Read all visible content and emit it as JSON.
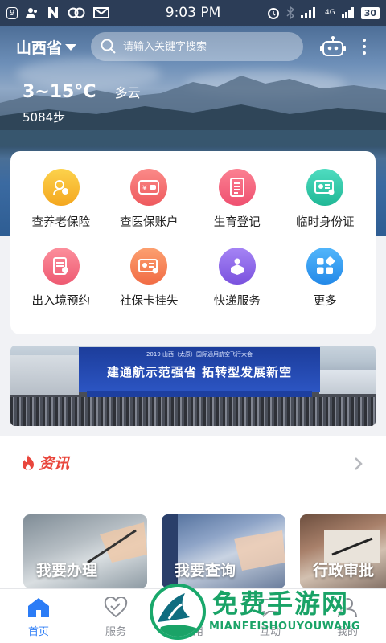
{
  "status_bar": {
    "notification_count": "9",
    "time": "9:03 PM",
    "network": "4G",
    "battery": "30"
  },
  "header": {
    "location": "山西省",
    "search_placeholder": "请输入关键字搜索"
  },
  "weather": {
    "temperature": "3~15°C",
    "condition": "多云",
    "steps": "5084步"
  },
  "services": [
    {
      "label": "查养老保险",
      "icon": "pension-icon",
      "color": "#f7b731"
    },
    {
      "label": "查医保账户",
      "icon": "medical-card-icon",
      "color": "#f26a6a"
    },
    {
      "label": "生育登记",
      "icon": "document-icon",
      "color": "#f2647d"
    },
    {
      "label": "临时身份证",
      "icon": "id-card-icon",
      "color": "#2cc8a8"
    },
    {
      "label": "出入境预约",
      "icon": "passport-icon",
      "color": "#f26a7c"
    },
    {
      "label": "社保卡挂失",
      "icon": "social-card-icon",
      "color": "#f5835a"
    },
    {
      "label": "快递服务",
      "icon": "delivery-icon",
      "color": "#8a63e6"
    },
    {
      "label": "更多",
      "icon": "more-grid-icon",
      "color": "#2f9bf0"
    }
  ],
  "banner": {
    "headline": "建通航示范强省  拓转型发展新空",
    "subline": "2019 山西（太原）国际通用航空飞行大会"
  },
  "news": {
    "title": "资讯",
    "tiles": [
      {
        "label": "我要办理"
      },
      {
        "label": "我要查询"
      },
      {
        "label": "行政审批"
      }
    ]
  },
  "bottom_nav": [
    {
      "label": "首页",
      "icon": "home-icon",
      "active": true
    },
    {
      "label": "服务",
      "icon": "heart-icon",
      "active": false
    },
    {
      "label": "应用",
      "icon": "apps-icon",
      "active": false
    },
    {
      "label": "互动",
      "icon": "chat-icon",
      "active": false
    },
    {
      "label": "我的",
      "icon": "user-icon",
      "active": false
    }
  ],
  "watermark": {
    "title": "免费手游网",
    "subtitle": "MIANFEISHOUYOUWANG"
  },
  "colors": {
    "accent": "#2b7cf6",
    "news_red": "#e9463c",
    "watermark_green": "#1aa367"
  }
}
